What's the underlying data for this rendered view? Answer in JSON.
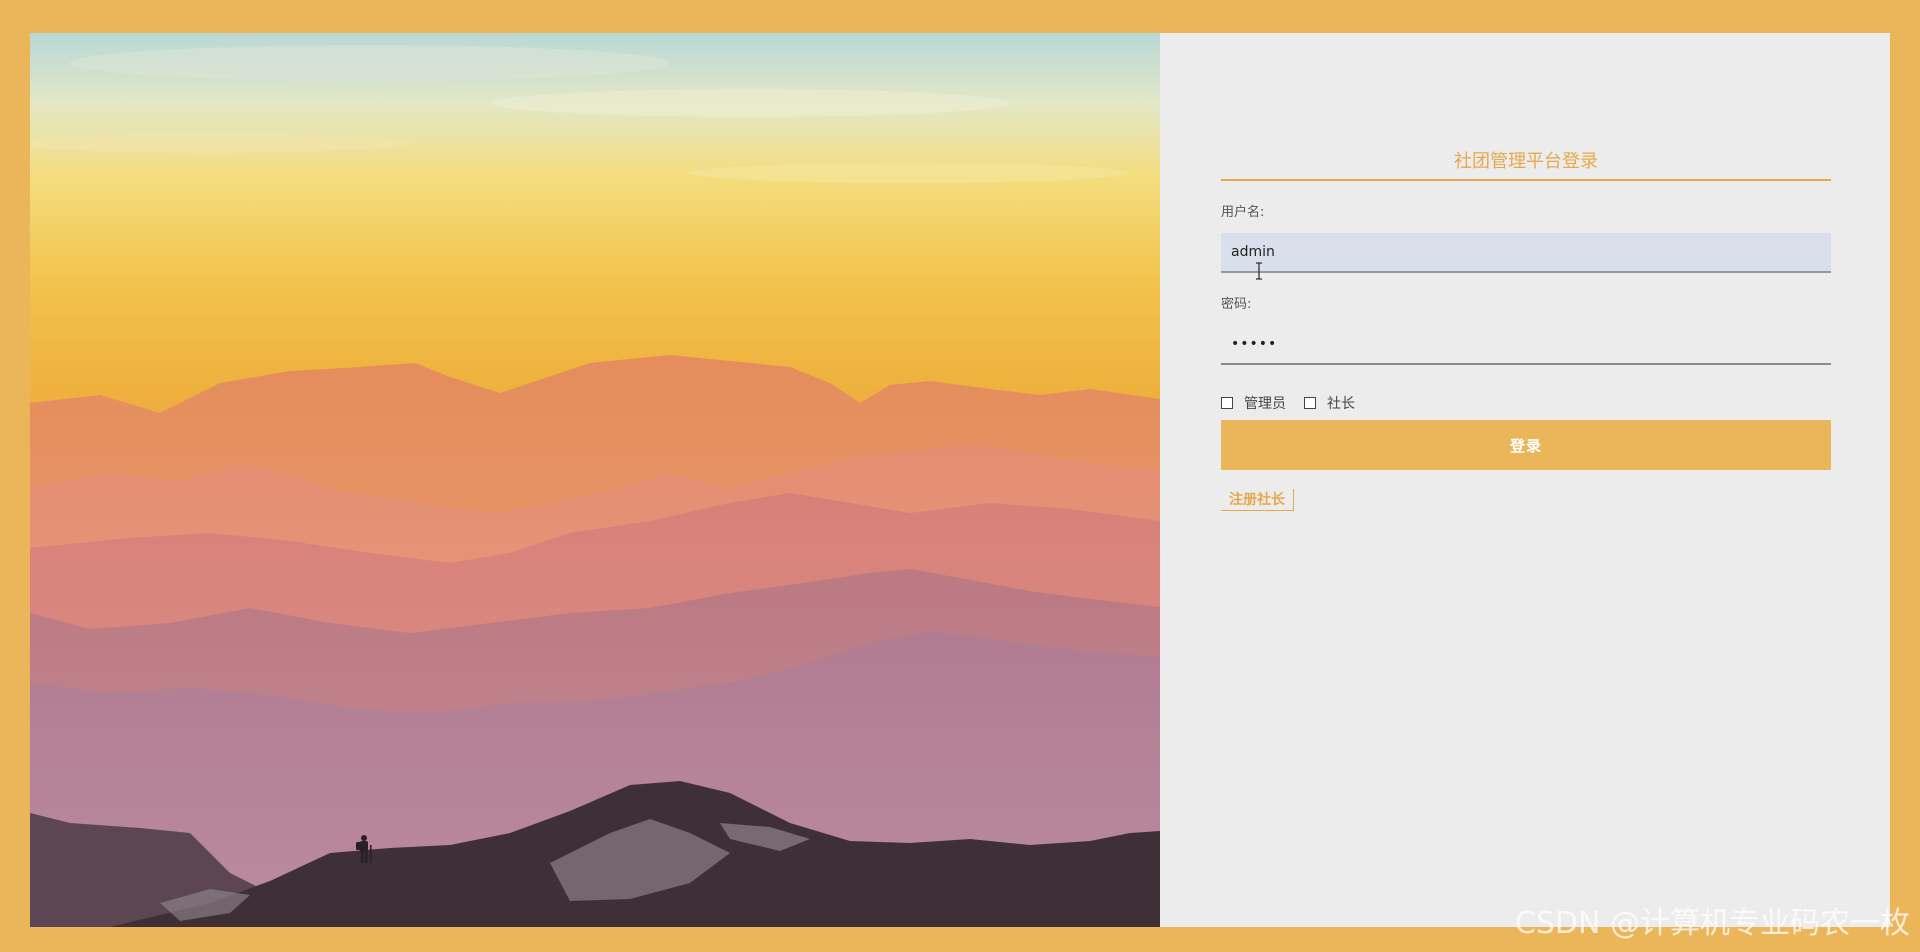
{
  "login": {
    "title": "社团管理平台登录",
    "username_label": "用户名:",
    "username_value": "admin",
    "password_label": "密码:",
    "password_value": "•••••",
    "role_options": [
      "管理员",
      "社长"
    ],
    "login_button": "登录",
    "register_link": "注册社长"
  },
  "watermark": "CSDN @计算机专业码农一枚",
  "colors": {
    "accent": "#ebb55a",
    "title_text": "#e6a84b",
    "panel_bg": "#ececec",
    "username_bg": "#d9e0ec"
  },
  "icons": [
    "text-cursor-icon"
  ]
}
